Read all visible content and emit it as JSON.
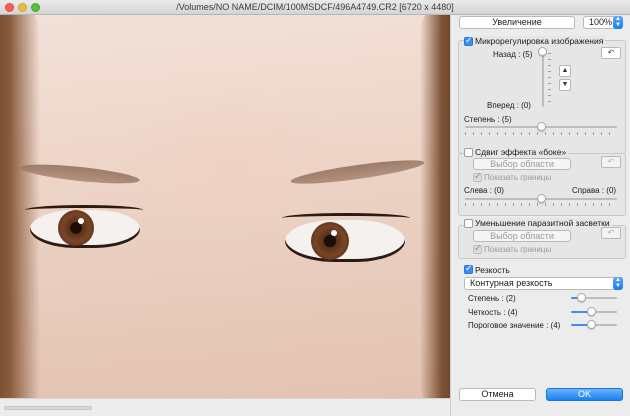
{
  "window": {
    "title": "/Volumes/NO NAME/DCIM/100MSDCF/496A4749.CR2 [6720 x 4480]"
  },
  "zoom": {
    "button_label": "Увеличение",
    "value": "100%"
  },
  "microadjust": {
    "title": "Микрорегулировка изображения",
    "checked": true,
    "back_label": "Назад : (5)",
    "forward_label": "Вперед : (0)",
    "strength_label": "Степень : (5)",
    "up_icon": "chevron-up-icon",
    "down_icon": "chevron-down-icon",
    "undo_icon": "undo-icon"
  },
  "bokeh": {
    "title": "Сдвиг эффекта «боке»",
    "checked": false,
    "select_area_label": "Выбор области",
    "show_borders_label": "Показать границы",
    "left_label": "Слева : (0)",
    "right_label": "Справа : (0)"
  },
  "flare": {
    "title": "Уменьшение паразитной засветки",
    "checked": false,
    "select_area_label": "Выбор области",
    "show_borders_label": "Показать границы"
  },
  "sharpness": {
    "title": "Резкость",
    "checked": true,
    "method": "Контурная резкость",
    "strength_label": "Степень : (2)",
    "strength_value": 0.22,
    "clarity_label": "Четкость : (4)",
    "clarity_value": 0.44,
    "threshold_label": "Пороговое значение : (4)",
    "threshold_value": 0.44
  },
  "footer": {
    "cancel_label": "Отмена",
    "ok_label": "OK"
  },
  "colors": {
    "accent": "#1a7df1",
    "close": "#fc5b57",
    "minimize": "#e5bf3c",
    "maximize": "#57c038"
  }
}
